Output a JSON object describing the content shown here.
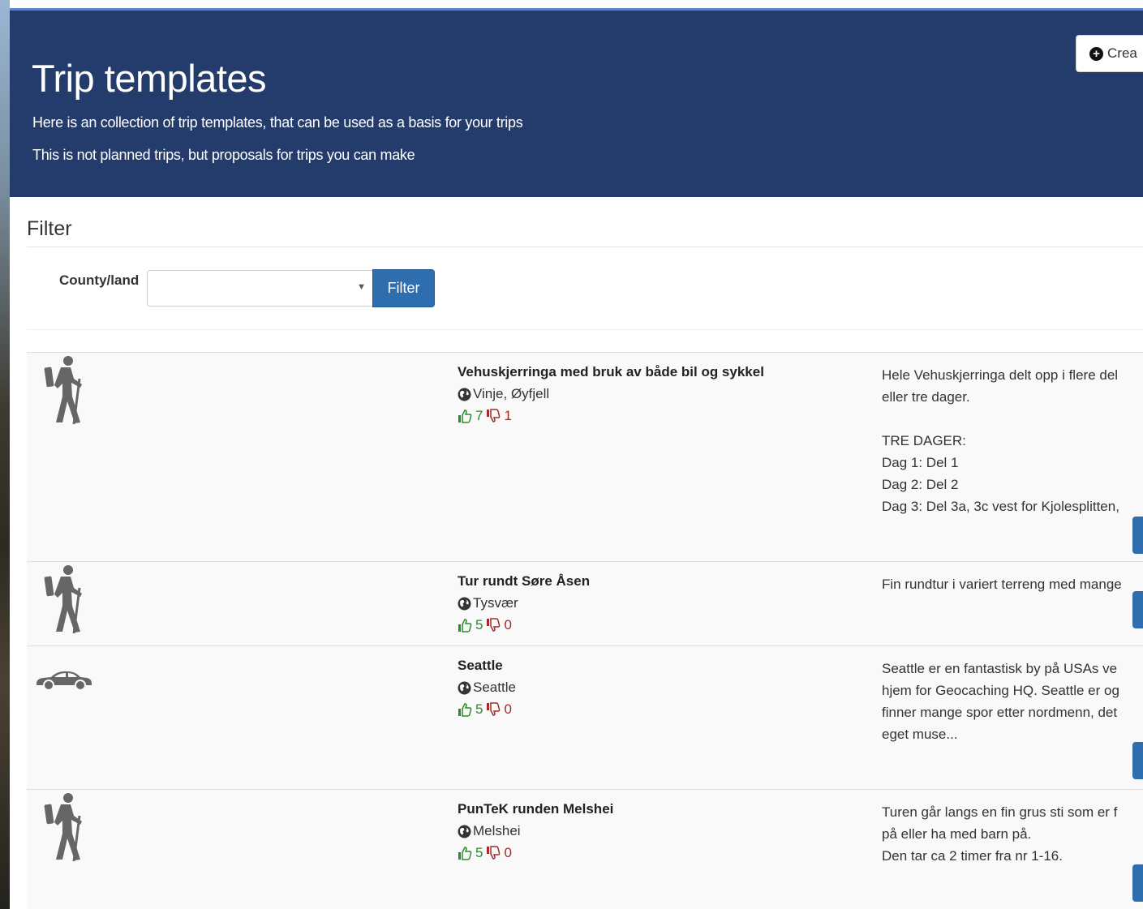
{
  "header": {
    "title": "Trip templates",
    "line1": "Here is an collection of trip templates, that can be used as a basis for your trips",
    "line2": "This is not planned trips, but proposals for trips you can make",
    "create_button": "Crea"
  },
  "filter": {
    "title": "Filter",
    "county_label": "County/land",
    "select_value": "",
    "button_label": "Filter"
  },
  "trips": [
    {
      "type": "hiking",
      "title": "Vehuskjerringa med bruk av både bil og sykkel",
      "location": "Vinje, Øyfjell",
      "likes": "7",
      "dislikes": "1",
      "description": [
        "Hele Vehuskjerringa delt opp i flere del",
        "eller tre dager.",
        "",
        "TRE DAGER:",
        "Dag 1: Del 1",
        "Dag 2: Del 2",
        "Dag 3: Del 3a, 3c vest for Kjolesplitten,"
      ]
    },
    {
      "type": "hiking",
      "title": "Tur rundt Søre Åsen",
      "location": "Tysvær",
      "likes": "5",
      "dislikes": "0",
      "description": [
        "Fin rundtur i variert terreng med mange"
      ]
    },
    {
      "type": "car",
      "title": "Seattle",
      "location": "Seattle",
      "likes": "5",
      "dislikes": "0",
      "description": [
        "Seattle er en fantastisk by på USAs ve",
        "hjem for Geocaching HQ. Seattle er og",
        "finner mange spor etter nordmenn, det",
        "eget muse..."
      ]
    },
    {
      "type": "hiking",
      "title": "PunTeK runden Melshei",
      "location": "Melshei",
      "likes": "5",
      "dislikes": "0",
      "description": [
        "Turen går langs en fin grus sti som er f",
        "på eller ha med barn på.",
        "Den tar ca 2 timer fra nr 1-16."
      ]
    }
  ]
}
